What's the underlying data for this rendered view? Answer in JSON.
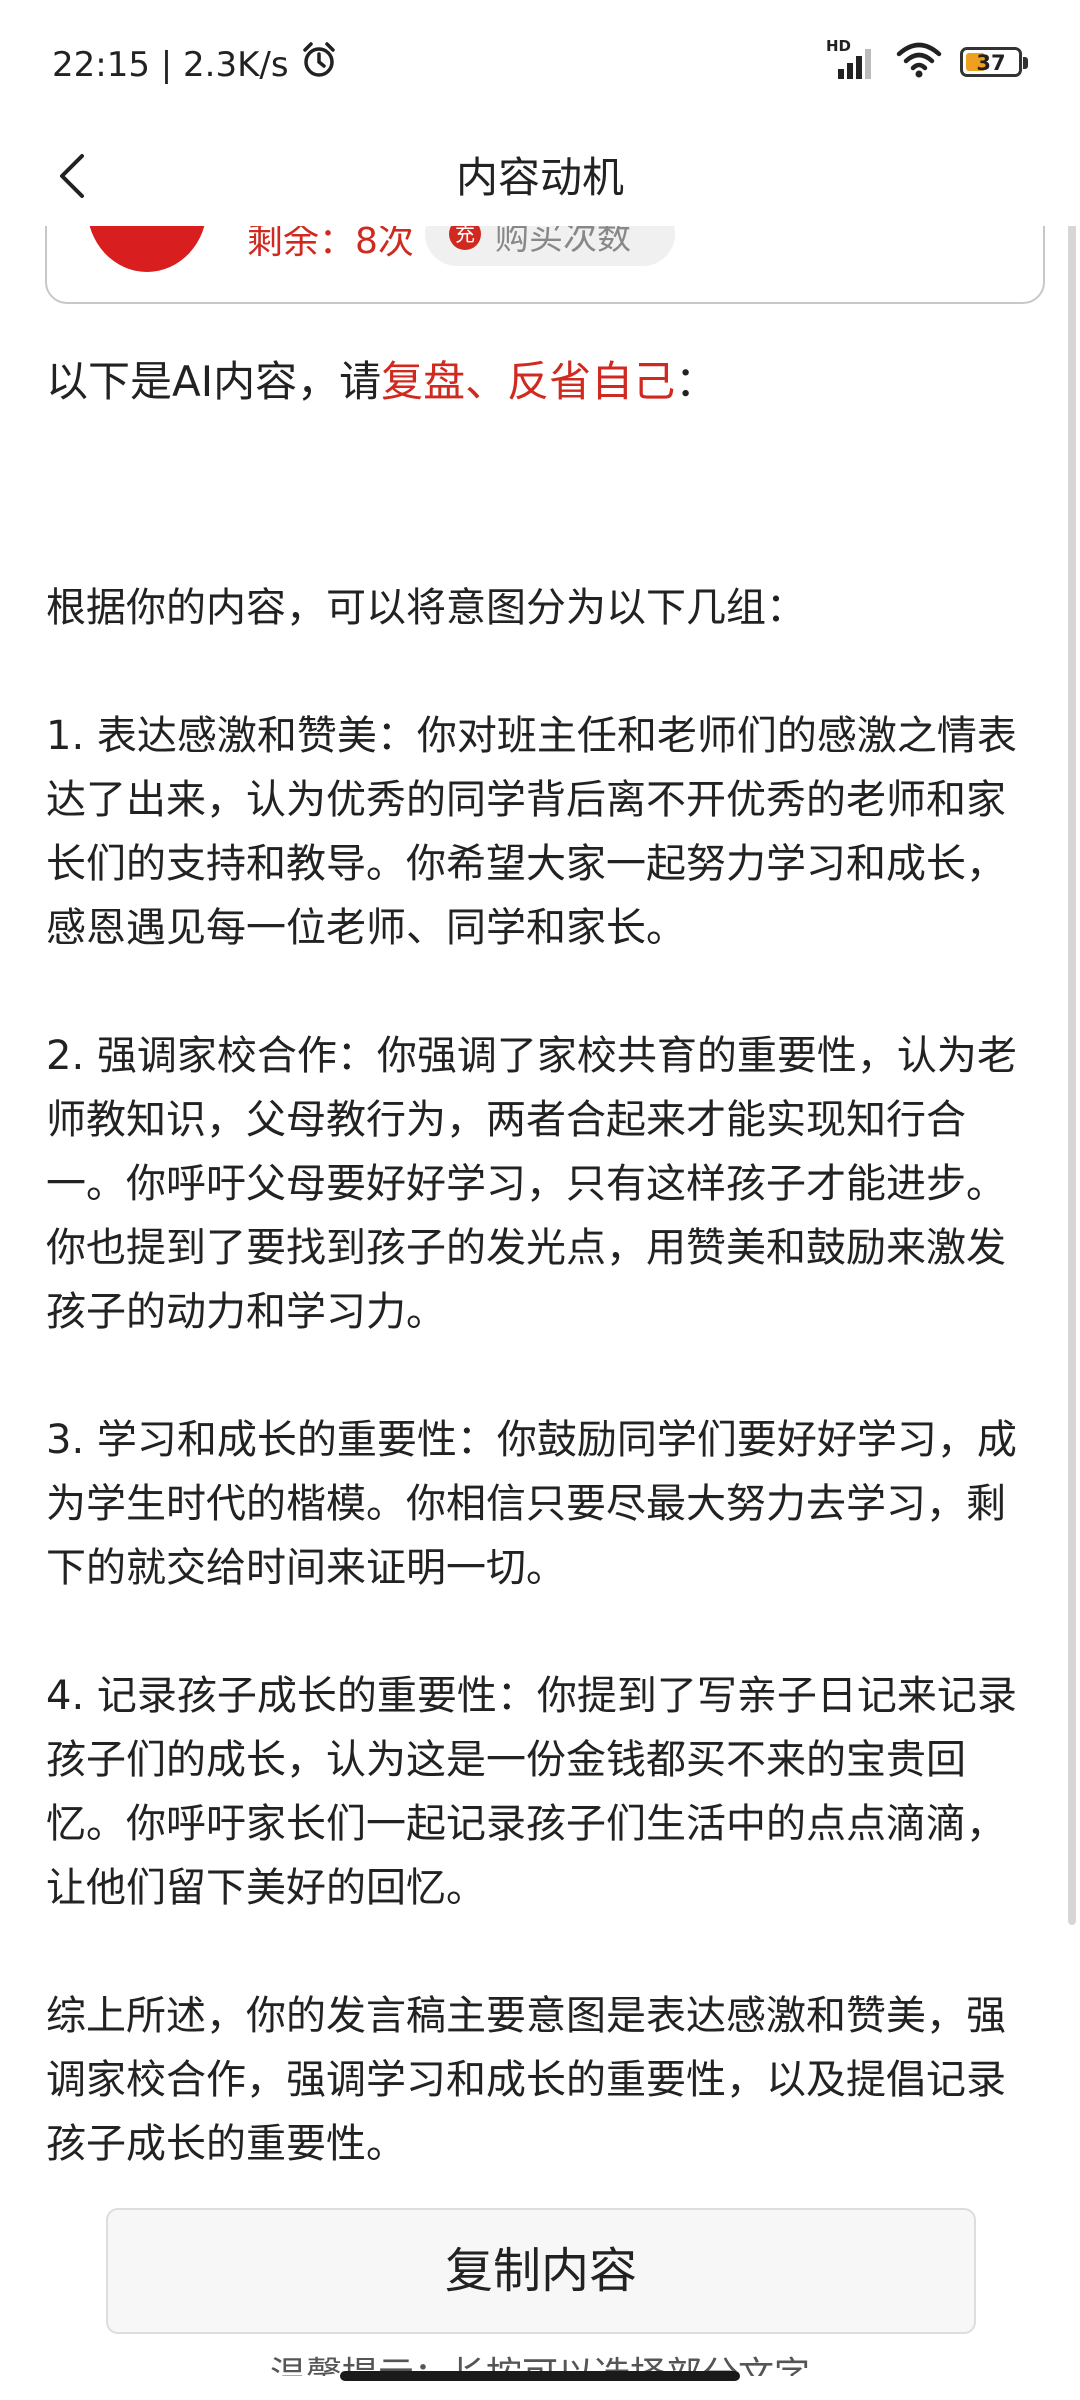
{
  "status_bar": {
    "time_speed": "22:15 | 2.3K/s",
    "network_type": "HD",
    "battery_level": "37",
    "battery_fraction": 0.37,
    "icons": [
      "alarm-icon",
      "signal-icon",
      "wifi-icon",
      "battery-icon"
    ]
  },
  "nav": {
    "title": "内容动机",
    "back_icon": "chevron-left-icon"
  },
  "top_card": {
    "remaining": "剩余：8次",
    "buy_label": "购买次数",
    "buy_icon_text": "充"
  },
  "content": {
    "intro_prefix": "以下是AI内容，请",
    "intro_highlight": "复盘、反省自己",
    "intro_suffix": "：",
    "lead": "根据你的内容，可以将意图分为以下几组：",
    "items": [
      "1. 表达感激和赞美：你对班主任和老师们的感激之情表达了出来，认为优秀的同学背后离不开优秀的老师和家长们的支持和教导。你希望大家一起努力学习和成长，感恩遇见每一位老师、同学和家长。",
      "2. 强调家校合作：你强调了家校共育的重要性，认为老师教知识，父母教行为，两者合起来才能实现知行合一。你呼吁父母要好好学习，只有这样孩子才能进步。你也提到了要找到孩子的发光点，用赞美和鼓励来激发孩子的动力和学习力。",
      "3. 学习和成长的重要性：你鼓励同学们要好好学习，成为学生时代的楷模。你相信只要尽最大努力去学习，剩下的就交给时间来证明一切。",
      "4. 记录孩子成长的重要性：你提到了写亲子日记来记录孩子们的成长，认为这是一份金钱都买不来的宝贵回忆。你呼吁家长们一起记录孩子们生活中的点点滴滴，让他们留下美好的回忆。"
    ],
    "summary": "综上所述，你的发言稿主要意图是表达感激和赞美，强调家校合作，强调学习和成长的重要性，以及提倡记录孩子成长的重要性。"
  },
  "copy_button": {
    "label": "复制内容"
  },
  "tip": {
    "text": "温馨提示：长按可以选择部分文字"
  },
  "colors": {
    "accent": "#d02a20",
    "battery": "#f0a020"
  }
}
